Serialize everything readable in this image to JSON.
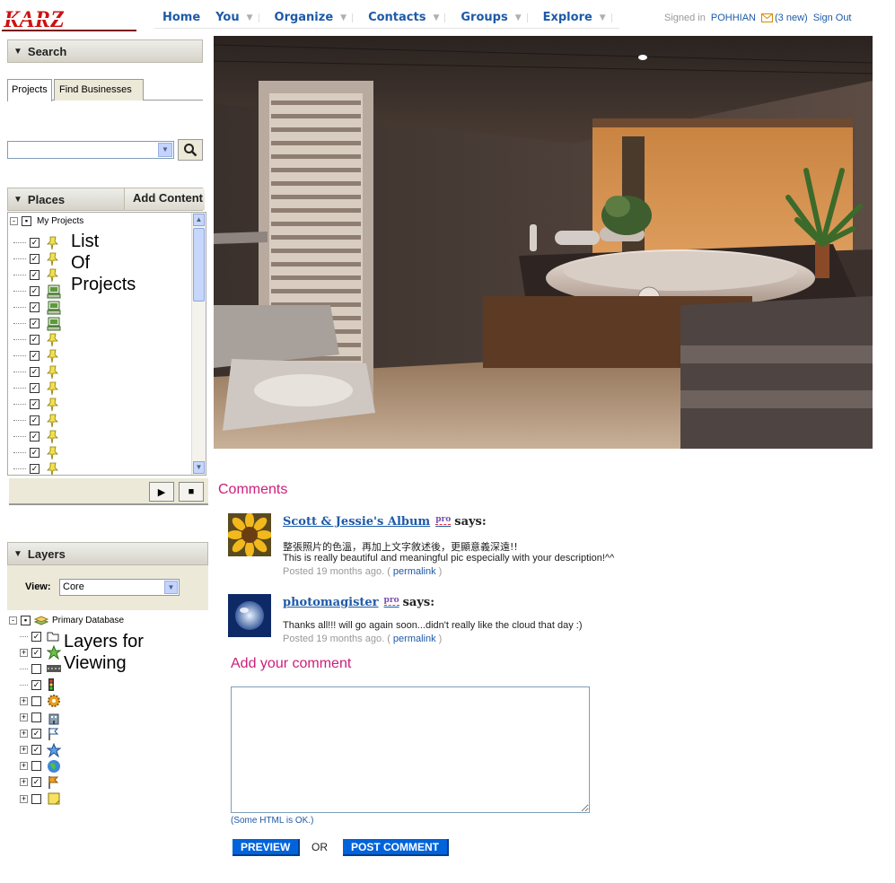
{
  "header": {
    "logo_text": "KARZ",
    "nav": [
      {
        "label": "Home",
        "has_menu": false
      },
      {
        "label": "You",
        "has_menu": true
      },
      {
        "label": "Organize",
        "has_menu": true
      },
      {
        "label": "Contacts",
        "has_menu": true
      },
      {
        "label": "Groups",
        "has_menu": true
      },
      {
        "label": "Explore",
        "has_menu": true
      }
    ],
    "signed_in_label": "Signed in",
    "username": "POHHIAN",
    "new_messages": "(3 new)",
    "sign_out": "Sign Out"
  },
  "search": {
    "title": "Search",
    "tabs": [
      "Projects",
      "Find Businesses"
    ],
    "active_tab": "Projects",
    "query": ""
  },
  "places": {
    "title": "Places",
    "add_content": "Add Content",
    "root": "My Projects",
    "overlay_label_lines": [
      "List",
      "Of",
      "Projects"
    ],
    "item_icons": [
      "pushpin",
      "pushpin",
      "pushpin",
      "network",
      "network",
      "network",
      "pushpin",
      "pushpin",
      "pushpin",
      "pushpin",
      "pushpin",
      "pushpin",
      "pushpin",
      "pushpin",
      "pushpin",
      "pushpin"
    ]
  },
  "player": {
    "play_icon": "play-icon",
    "stop_icon": "stop-icon"
  },
  "layers": {
    "title": "Layers",
    "view_label": "View:",
    "view_value": "Core",
    "root": "Primary Database",
    "overlay_label_lines": [
      "Layers for",
      "Viewing"
    ],
    "items": [
      {
        "icon": "folder",
        "checked": true,
        "expandable": false
      },
      {
        "icon": "star-green",
        "checked": true,
        "expandable": true
      },
      {
        "icon": "road",
        "checked": false,
        "expandable": false
      },
      {
        "icon": "traffic-light",
        "checked": true,
        "expandable": false
      },
      {
        "icon": "gear",
        "checked": false,
        "expandable": true
      },
      {
        "icon": "building",
        "checked": false,
        "expandable": true
      },
      {
        "icon": "flag",
        "checked": true,
        "expandable": true
      },
      {
        "icon": "star-blue",
        "checked": true,
        "expandable": true
      },
      {
        "icon": "globe",
        "checked": false,
        "expandable": true
      },
      {
        "icon": "flag-orange",
        "checked": true,
        "expandable": true
      },
      {
        "icon": "note",
        "checked": false,
        "expandable": true
      }
    ]
  },
  "comments": {
    "title": "Comments",
    "items": [
      {
        "author": "Scott & Jessie's Album",
        "badge": "pro",
        "says": "says:",
        "lines": [
          "整張照片的色溫，再加上文字敘述後，更顯意義深遠!!",
          "This is really beautiful and meaningful pic especially with your description!^^"
        ],
        "posted": "Posted 19 months ago. (",
        "permalink": "permalink",
        "close": ")"
      },
      {
        "author": "photomagister",
        "badge": "pro",
        "says": "says:",
        "lines": [
          "Thanks all!!! will go again soon...didn't really like the cloud that day :)"
        ],
        "posted": "Posted 19 months ago. (",
        "permalink": "permalink",
        "close": ")"
      }
    ]
  },
  "add_comment": {
    "title": "Add your comment",
    "text": "",
    "note": "(Some HTML is OK.)",
    "preview": "PREVIEW",
    "or": "OR",
    "post": "POST COMMENT"
  },
  "colors": {
    "link": "#1e5aa8",
    "accent": "#cc1e7a",
    "button": "#0063dc",
    "logo": "#cc1111"
  }
}
